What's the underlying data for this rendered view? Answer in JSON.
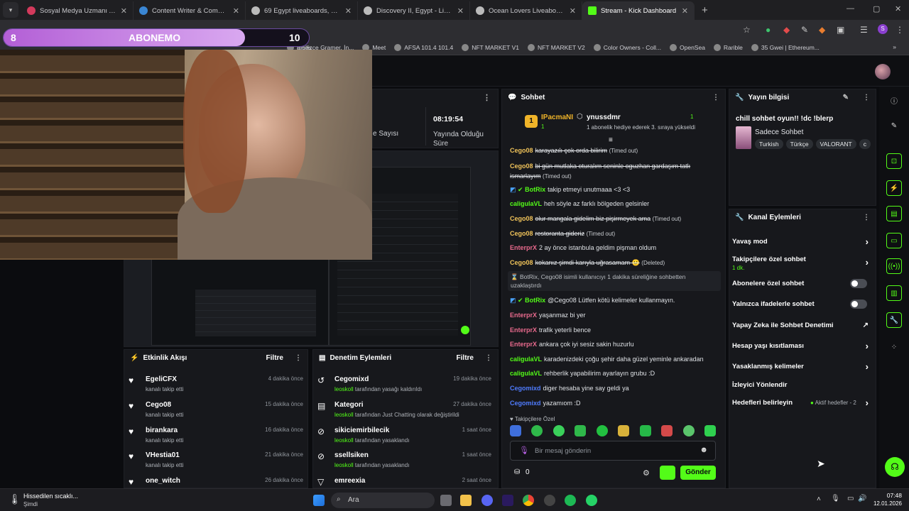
{
  "browser": {
    "tabs": [
      {
        "title": "Sosyal Medya Uzmanı Arannıyor",
        "color": "#d33a5c"
      },
      {
        "title": "Content Writer & Community M",
        "color": "#3a86d3"
      },
      {
        "title": "69 Egypt liveaboards, May 2026",
        "color": "#888888"
      },
      {
        "title": "Discovery II, Egypt - LiveAboard",
        "color": "#888888"
      },
      {
        "title": "Ocean Lovers Liveaboard, Egypt",
        "color": "#888888"
      },
      {
        "title": "Stream - Kick Dashboard",
        "color": "#53fc18"
      }
    ],
    "bookmarks": [
      "İngilizce Gramer, İn...",
      "Meet",
      "AFSA 101.4 101.4",
      "NFT MARKET V1",
      "NFT MARKET V2",
      "Color Owners - Coll...",
      "OpenSea",
      "Rarible",
      "35 Gwei | Ethereum..."
    ],
    "bookmark_partial": "arşes"
  },
  "overlay": {
    "left_num": "8",
    "label": "ABONEMO",
    "right_num": "10"
  },
  "stats": {
    "partial_label": "e Sayısı",
    "uptime": "08:19:54",
    "uptime_label": "Yayında Olduğu Süre"
  },
  "chat": {
    "title": "Sohbet",
    "top_gifter": {
      "name": "IPacmaNI",
      "rank": "1",
      "count": "1"
    },
    "top_viewer": {
      "name": "ynussdmr",
      "count": "1",
      "note": "1 abonelik hediye ederek 3. sıraya yükseldi"
    },
    "messages": [
      {
        "user": "Cego08",
        "text": "karayazılı çok orda bilirim",
        "tag": "(Timed out)",
        "color": "#f0c35a",
        "strike": true
      },
      {
        "user": "Cego08",
        "text": "bi gün mutlaka oturalım seninle oguzhan gardaşım tatlı ismarlayım",
        "tag": "(Timed out)",
        "color": "#f0c35a",
        "strike": true
      },
      {
        "user": "BotRix",
        "text": "takip etmeyi unutmaaa <3 <3",
        "tag": "",
        "color": "#53fc18",
        "strike": false
      },
      {
        "user": "caligulaVL",
        "text": "heh söyle az farklı bölgeden gelsinler",
        "tag": "",
        "color": "#53fc18",
        "strike": false
      },
      {
        "user": "Cego08",
        "text": "olur mangala gidelim biz pişirmeyek ama",
        "tag": "(Timed out)",
        "color": "#f0c35a",
        "strike": true
      },
      {
        "user": "Cego08",
        "text": "restoranta gideriz",
        "tag": "(Timed out)",
        "color": "#f0c35a",
        "strike": true
      },
      {
        "user": "EnterprX",
        "text": "2 ay önce istanbula geldim pişman oldum",
        "tag": "",
        "color": "#e96a8d",
        "strike": false
      },
      {
        "user": "Cego08",
        "text": "kokanız şimdi karıyla uğrasamam 🙂",
        "tag": "(Deleted)",
        "color": "#f0c35a",
        "strike": true
      }
    ],
    "system_notice": "BotRix, Cego08 isimli kullanıcıyı 1 dakika süreliğine sohbetten uzaklaştırdı",
    "messages2": [
      {
        "user": "BotRix",
        "text": "@Cego08 Lütfen kötü kelimeler kullanmayın.",
        "color": "#53fc18"
      },
      {
        "user": "EnterprX",
        "text": "yaşanmaz bi yer",
        "color": "#e96a8d"
      },
      {
        "user": "EnterprX",
        "text": "trafik yeterli bence",
        "color": "#e96a8d"
      },
      {
        "user": "EnterprX",
        "text": "ankara çok iyi sesiz sakin huzurlu",
        "color": "#e96a8d"
      },
      {
        "user": "caligulaVL",
        "text": "karadenizdeki çoğu şehir daha güzel yeminle ankaradan",
        "color": "#53fc18"
      },
      {
        "user": "caligulaVL",
        "text": "rehberlik yapabilirim ayarlayın grubu :D",
        "color": "#53fc18"
      },
      {
        "user": "Cegomixd",
        "text": "diger hesaba yine say geldi ya",
        "color": "#4f7cff"
      },
      {
        "user": "Cegomixd",
        "text": "yazamıom :D",
        "color": "#4f7cff"
      }
    ],
    "followers_only": "Takipçilere Özel",
    "input_placeholder": "Bir mesaj gönderin",
    "points": "0",
    "send": "Gönder"
  },
  "stream_info": {
    "title": "Yayın bilgisi",
    "stream_title": "chill sohbet oyun!! !dc !blerp",
    "category": "Sadece Sohbet",
    "tags": [
      "Turkish",
      "Türkçe",
      "VALORANT",
      "c"
    ]
  },
  "channel_actions": {
    "title": "Kanal Eylemleri",
    "slow": "Yavaş mod",
    "followers": "Takipçilere özel sohbet",
    "followers_sub": "1 dk.",
    "subs": "Abonelere özel sohbet",
    "emotes": "Yalnızca ifadelerle sohbet",
    "ai": "Yapay Zeka ile Sohbet Denetimi",
    "age": "Hesap yaşı kısıtlaması",
    "banned": "Yasaklanmış kelimeler",
    "redirect": "İzleyici Yönlendir",
    "goals": "Hedefleri belirleyin",
    "goals_status": "Aktif hedefler - 2"
  },
  "activity": {
    "title": "Etkinlik Akışı",
    "filter": "Filtre",
    "items": [
      {
        "name": "EgeliCFX",
        "sub": "kanalı takip etti",
        "time": "4 dakika önce"
      },
      {
        "name": "Cego08",
        "sub": "kanalı takip etti",
        "time": "15 dakika önce"
      },
      {
        "name": "birankara",
        "sub": "kanalı takip etti",
        "time": "16 dakika önce"
      },
      {
        "name": "VHestia01",
        "sub": "kanalı takip etti",
        "time": "21 dakika önce"
      },
      {
        "name": "one_witch",
        "sub": "",
        "time": "26 dakika önce"
      }
    ]
  },
  "moderation": {
    "title": "Denetim Eylemleri",
    "filter": "Filtre",
    "items": [
      {
        "name": "Cegomixd",
        "actor": "leoskoll",
        "rest": "tarafından yasağı kaldırıldı",
        "time": "19 dakika önce"
      },
      {
        "name": "Kategori",
        "actor": "leoskoll",
        "rest": "tarafından Just Chatting olarak değiştirildi",
        "time": "27 dakika önce"
      },
      {
        "name": "sikiciemirbilecik",
        "actor": "leoskoll",
        "rest": "tarafından yasaklandı",
        "time": "1 saat önce"
      },
      {
        "name": "ssellsiken",
        "actor": "leoskoll",
        "rest": "tarafından yasaklandı",
        "time": "1 saat önce"
      },
      {
        "name": "emreexia",
        "actor": "",
        "rest": "",
        "time": "2 saat önce"
      }
    ]
  },
  "taskbar": {
    "weather": "Hissedilen sıcaklı...",
    "weather_sub": "Şimdi",
    "search": "Ara",
    "time": "07:48",
    "date": "12.01.2026"
  }
}
